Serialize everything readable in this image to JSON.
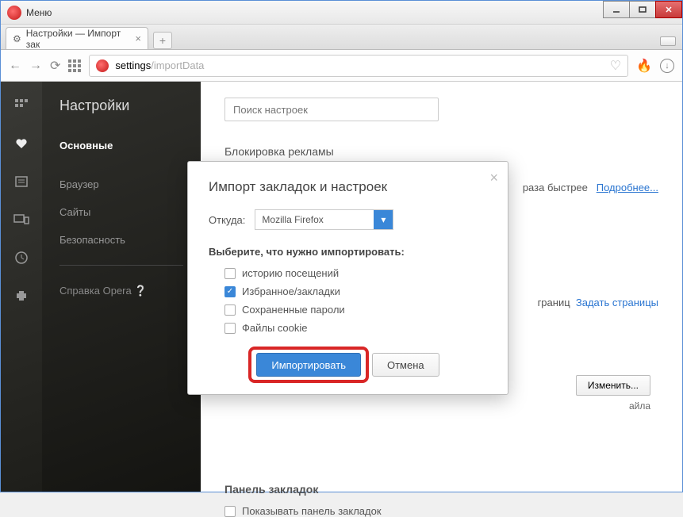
{
  "window": {
    "menu_label": "Меню"
  },
  "tab": {
    "title": "Настройки — Импорт зак"
  },
  "address": {
    "host": "settings",
    "path": "/importData"
  },
  "sidebar": {
    "title": "Настройки",
    "items": [
      {
        "label": "Основные"
      },
      {
        "label": "Браузер"
      },
      {
        "label": "Сайты"
      },
      {
        "label": "Безопасность"
      }
    ],
    "help": "Справка Opera"
  },
  "main": {
    "search_placeholder": "Поиск настроек",
    "ad_block_header": "Блокировка рекламы",
    "faster_text": "раза быстрее",
    "learn_more": "Подробнее...",
    "pages_text": "границ",
    "set_pages": "Задать страницы",
    "change_btn": "Изменить...",
    "file_txt": "айла",
    "bookmark_bar_header": "Панель закладок",
    "show_bookmark_bar": "Показывать панель закладок"
  },
  "modal": {
    "title": "Импорт закладок и настроек",
    "from_label": "Откуда:",
    "from_value": "Mozilla Firefox",
    "select_header": "Выберите, что нужно импортировать:",
    "options": [
      {
        "label": "историю посещений",
        "checked": false
      },
      {
        "label": "Избранное/закладки",
        "checked": true
      },
      {
        "label": "Сохраненные пароли",
        "checked": false
      },
      {
        "label": "Файлы cookie",
        "checked": false
      }
    ],
    "import_btn": "Импортировать",
    "cancel_btn": "Отмена"
  }
}
